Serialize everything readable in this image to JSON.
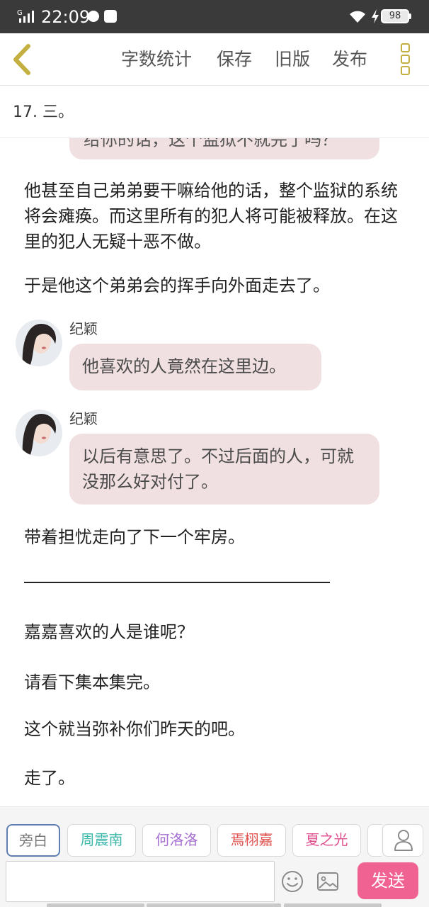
{
  "status_bar": {
    "network": "G",
    "time": "22:09",
    "battery": "98"
  },
  "toolbar": {
    "back_icon": "chevron-left-icon",
    "word_count": "字数统计",
    "save": "保存",
    "old_version": "旧版",
    "publish": "发布",
    "more_icon": "more-vertical-icon",
    "accent_color": "#c3b041"
  },
  "chapter": {
    "title": "17. 三。"
  },
  "content": {
    "cut_bubble_text": "给你的话，这个监狱不就完了吗？",
    "paragraphs": [
      "他甚至自己弟弟要干嘛给他的话，整个监狱的系统将会瘫痪。而这里所有的犯人将可能被释放。在这里的犯人无疑十恶不做。",
      "于是他这个弟弟会的挥手向外面走去了。",
      "带着担忧走向了下一个牢房。",
      "嘉嘉喜欢的人是谁呢？",
      "请看下集本集完。",
      "这个就当弥补你们昨天的吧。",
      "走了。"
    ],
    "messages": [
      {
        "speaker": "纪颖",
        "text": "他喜欢的人竟然在这里边。"
      },
      {
        "speaker": "纪颖",
        "text": "以后有意思了。不过后面的人，可就没那么好对付了。"
      }
    ],
    "bubble_color": "#f1e0e1"
  },
  "bottom_bar": {
    "characters": [
      {
        "name": "旁白",
        "color": "#777777",
        "selected": true
      },
      {
        "name": "周震南",
        "color": "#3bb7a9",
        "selected": false
      },
      {
        "name": "何洛洛",
        "color": "#a56cd1",
        "selected": false
      },
      {
        "name": "焉栩嘉",
        "color": "#e0504d",
        "selected": false
      },
      {
        "name": "夏之光",
        "color": "#e0508f",
        "selected": false
      }
    ],
    "user_icon": "user-icon",
    "input_value": "",
    "emoji_icon": "smiley-icon",
    "image_icon": "image-icon",
    "send": "发送",
    "send_color": "#f06292"
  }
}
